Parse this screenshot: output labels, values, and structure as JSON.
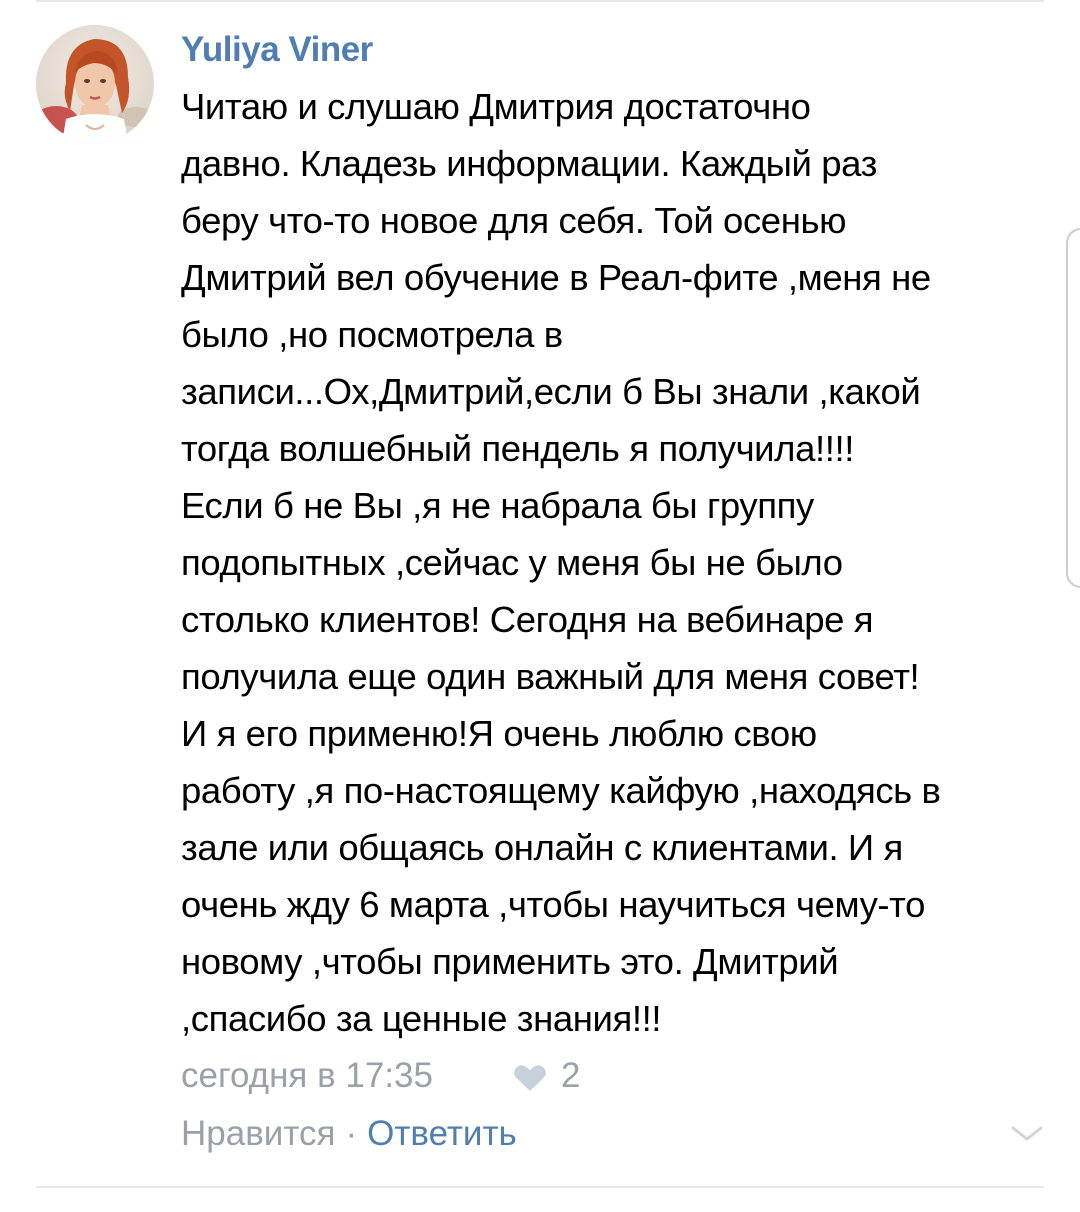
{
  "comment": {
    "author": "Yuliya Viner",
    "text_lines": [
      "Читаю и слушаю Дмитрия достаточно",
      "давно. Кладезь информации. Каждый раз",
      "беру что-то новое для себя. Той осенью",
      "Дмитрий вел обучение в Реал-фите ,меня не",
      "было ,но посмотрела в",
      "записи...Ох,Дмитрий,если б Вы знали ,какой",
      "тогда волшебный пендель я получила!!!!",
      "Если б не Вы ,я не набрала бы группу",
      "подопытных ,сейчас у меня бы не было",
      "столько клиентов! Сегодня на вебинаре я",
      "получила еще один важный для меня совет!",
      "И я его применю!Я очень люблю свою",
      "работу ,я по-настоящему кайфую ,находясь в",
      "зале или общаясь онлайн с клиентами. И я",
      "очень жду 6 марта ,чтобы научиться чему-то",
      "новому ,чтобы применить это. Дмитрий",
      ",спасибо за ценные знания!!!"
    ],
    "timestamp": "сегодня в 17:35",
    "like_icon": "heart-icon",
    "likes_count": "2",
    "like_action_label": "Нравится",
    "separator": "·",
    "reply_action_label": "Ответить",
    "expand_icon": "chevron-down-icon"
  },
  "colors": {
    "author": "#4f7fb0",
    "link": "#4f7fb0",
    "meta": "#9aa1a9",
    "heart": "#c7d1dc",
    "divider": "#e7e8ec"
  }
}
